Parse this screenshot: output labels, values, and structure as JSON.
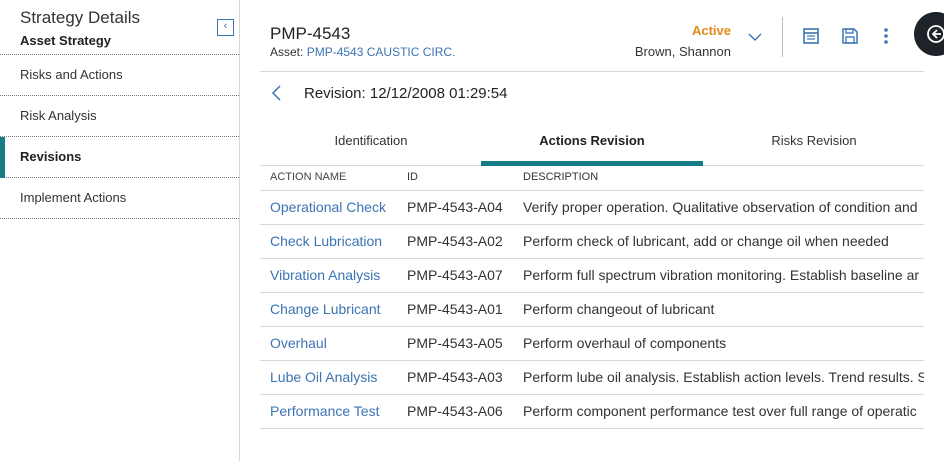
{
  "sidebar": {
    "title": "Strategy Details",
    "subtitle": "Asset Strategy",
    "items": [
      {
        "label": "Risks and Actions"
      },
      {
        "label": "Risk Analysis"
      },
      {
        "label": "Revisions",
        "active": true
      },
      {
        "label": "Implement Actions"
      }
    ]
  },
  "header": {
    "asset_id": "PMP-4543",
    "asset_prefix": "Asset:",
    "asset_link": "PMP-4543 CAUSTIC CIRC.",
    "status": "Active",
    "owner": "Brown, Shannon",
    "icons": [
      "table-view-icon",
      "save-icon",
      "more-options-icon",
      "collapse-panel-icon"
    ]
  },
  "revision": {
    "label": "Revision: 12/12/2008 01:29:54"
  },
  "tabs": [
    {
      "label": "Identification"
    },
    {
      "label": "Actions Revision",
      "active": true
    },
    {
      "label": "Risks Revision"
    }
  ],
  "table": {
    "columns": [
      "ACTION NAME",
      "ID",
      "DESCRIPTION"
    ],
    "rows": [
      {
        "name": "Operational Check",
        "id": "PMP-4543-A04",
        "desc": "Verify proper operation. Qualitative observation of condition and"
      },
      {
        "name": "Check Lubrication",
        "id": "PMP-4543-A02",
        "desc": "Perform check of lubricant, add or change oil when needed"
      },
      {
        "name": "Vibration Analysis",
        "id": "PMP-4543-A07",
        "desc": "Perform full spectrum vibration monitoring. Establish baseline ar"
      },
      {
        "name": "Change Lubricant",
        "id": "PMP-4543-A01",
        "desc": "Perform changeout of lubricant"
      },
      {
        "name": "Overhaul",
        "id": "PMP-4543-A05",
        "desc": "Perform overhaul of components"
      },
      {
        "name": "Lube Oil Analysis",
        "id": "PMP-4543-A03",
        "desc": "Perform lube oil analysis. Establish action levels. Trend results. S"
      },
      {
        "name": "Performance Test",
        "id": "PMP-4543-A06",
        "desc": "Perform component performance test over full range of operatic"
      }
    ]
  },
  "colors": {
    "accent": "#167c86",
    "link": "#3b74b3",
    "status_active": "#e48a1d"
  }
}
